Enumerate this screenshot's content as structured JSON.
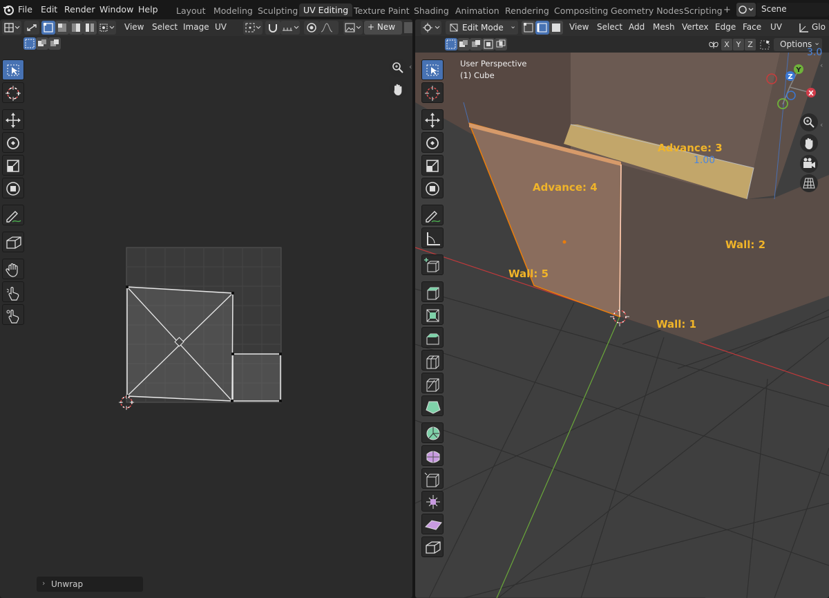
{
  "menus": [
    "File",
    "Edit",
    "Render",
    "Window",
    "Help"
  ],
  "workspaces": [
    "Layout",
    "Modeling",
    "Sculpting",
    "UV Editing",
    "Texture Paint",
    "Shading",
    "Animation",
    "Rendering",
    "Compositing",
    "Geometry Nodes",
    "Scripting"
  ],
  "active_workspace": "UV Editing",
  "scene": {
    "label": "Scene"
  },
  "uv_editor": {
    "header_menus": [
      "View",
      "Select",
      "Image",
      "UV"
    ],
    "new_button": "+ New",
    "operator_panel": "Unwrap"
  },
  "viewport": {
    "mode": "Edit Mode",
    "header_menus": [
      "View",
      "Select",
      "Add",
      "Mesh",
      "Vertex",
      "Edge",
      "Face",
      "UV"
    ],
    "global_label": "Glo",
    "axes_buttons": [
      "X",
      "Y",
      "Z"
    ],
    "options_label": "Options",
    "perspective": "User Perspective",
    "object": "(1) Cube",
    "corner_value": "3.0",
    "gizmo_labels": {
      "z": "Z",
      "y": "Y",
      "x": "X"
    },
    "labels": {
      "advance3": "Advance: 3",
      "advance4": "Advance: 4",
      "value": "1.00",
      "wall2": "Wall: 2",
      "wall5": "Wall: 5",
      "wall1": "Wall: 1"
    }
  },
  "colors": {
    "accent": "#4772b3",
    "annotation": "#f0b429",
    "face_highlight": "#e87d0d"
  }
}
